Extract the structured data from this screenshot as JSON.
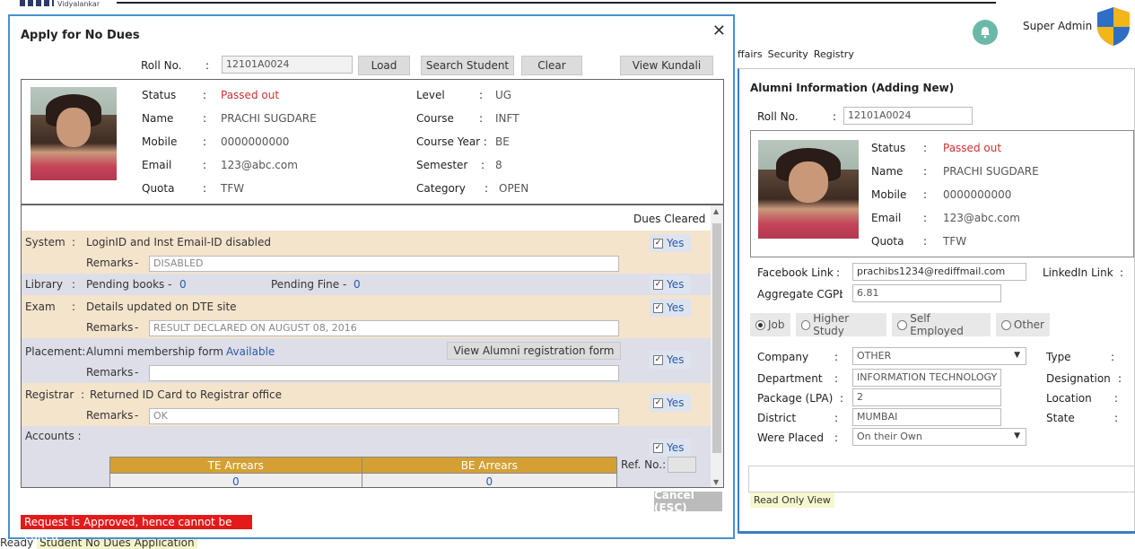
{
  "app": {
    "brand": "Vidyalankar",
    "user": "Super Admin"
  },
  "background_window": {
    "menu": [
      "ffairs",
      "Security",
      "Registry"
    ],
    "title": "Alumni Information (Adding New)",
    "roll_label": "Roll No.",
    "roll_value": "12101A0024",
    "profile": {
      "status_label": "Status",
      "status_value": "Passed out",
      "name_label": "Name",
      "name_value": "PRACHI SUGDARE",
      "mobile_label": "Mobile",
      "mobile_value": "0000000000",
      "email_label": "Email",
      "email_value": "123@abc.com",
      "quota_label": "Quota",
      "quota_value": "TFW"
    },
    "facebook_label": "Facebook Link",
    "facebook_value": "prachibs1234@rediffmail.com",
    "linkedin_label": "LinkedIn Link",
    "cgpi_label": "Aggregate CGPI",
    "cgpi_value": "6.81",
    "options": [
      "Job",
      "Higher Study",
      "Self Employed",
      "Other"
    ],
    "selected_option": "Job",
    "company_label": "Company",
    "company_value": "OTHER",
    "type_label": "Type",
    "department_label": "Department",
    "department_value": "INFORMATION TECHNOLOGY",
    "designation_label": "Designation",
    "package_label": "Package (LPA)",
    "package_value": "2",
    "location_label": "Location",
    "district_label": "District",
    "district_value": "MUMBAI",
    "state_label": "State",
    "placed_label": "Were Placed",
    "placed_value": "On their Own",
    "readonly_label": "Read Only View"
  },
  "dialog": {
    "title": "Apply for No Dues",
    "roll_label": "Roll No.",
    "roll_value": "12101A0024",
    "buttons": {
      "load": "Load",
      "search": "Search Student",
      "clear": "Clear",
      "kundali": "View Kundali",
      "cancel": "Cancel (ESC)"
    },
    "student": {
      "status_label": "Status",
      "status_value": "Passed out",
      "name_label": "Name",
      "name_value": "PRACHI SUGDARE",
      "mobile_label": "Mobile",
      "mobile_value": "0000000000",
      "email_label": "Email",
      "email_value": "123@abc.com",
      "quota_label": "Quota",
      "quota_value": "TFW",
      "level_label": "Level",
      "level_value": "UG",
      "course_label": "Course",
      "course_value": "INFT",
      "course_year_label": "Course Year :",
      "course_year_value": "BE",
      "semester_label": "Semester",
      "semester_value": "8",
      "category_label": "Category",
      "category_value": "OPEN"
    },
    "dues_header": "Dues Cleared",
    "yes": "Yes",
    "remarks_label": "Remarks",
    "system": {
      "label": "System",
      "text": "LoginID and Inst Email-ID disabled",
      "remarks": "DISABLED"
    },
    "library": {
      "label": "Library",
      "books_label": "Pending books -",
      "books_value": "0",
      "fine_label": "Pending Fine -",
      "fine_value": "0"
    },
    "exam": {
      "label": "Exam",
      "text": "Details updated on DTE site",
      "remarks": "RESULT DECLARED ON AUGUST 08, 2016"
    },
    "placement": {
      "label": "Placement:",
      "text": "Alumni membership form",
      "status": "Available",
      "button": "View Alumni registration form",
      "remarks": ""
    },
    "registrar": {
      "label": "Registrar",
      "text": "Returned ID Card to Registrar office",
      "remarks": "OK"
    },
    "accounts": {
      "label": "Accounts :",
      "te_header": "TE Arrears",
      "be_header": "BE Arrears",
      "te_value": "0",
      "be_value": "0",
      "ref_label": "Ref. No.:"
    },
    "approved_message": "Request is Approved, hence cannot be edited"
  },
  "statusbar": {
    "ready": "Ready",
    "app": "Student No Dues Application"
  },
  "colors": {
    "accent": "#4a8fcf",
    "tan_row": "#f4e4cc",
    "lavender_row": "#dedee8",
    "gold_header": "#d4a033",
    "error": "#e21a1a",
    "status_red": "#d03030"
  }
}
